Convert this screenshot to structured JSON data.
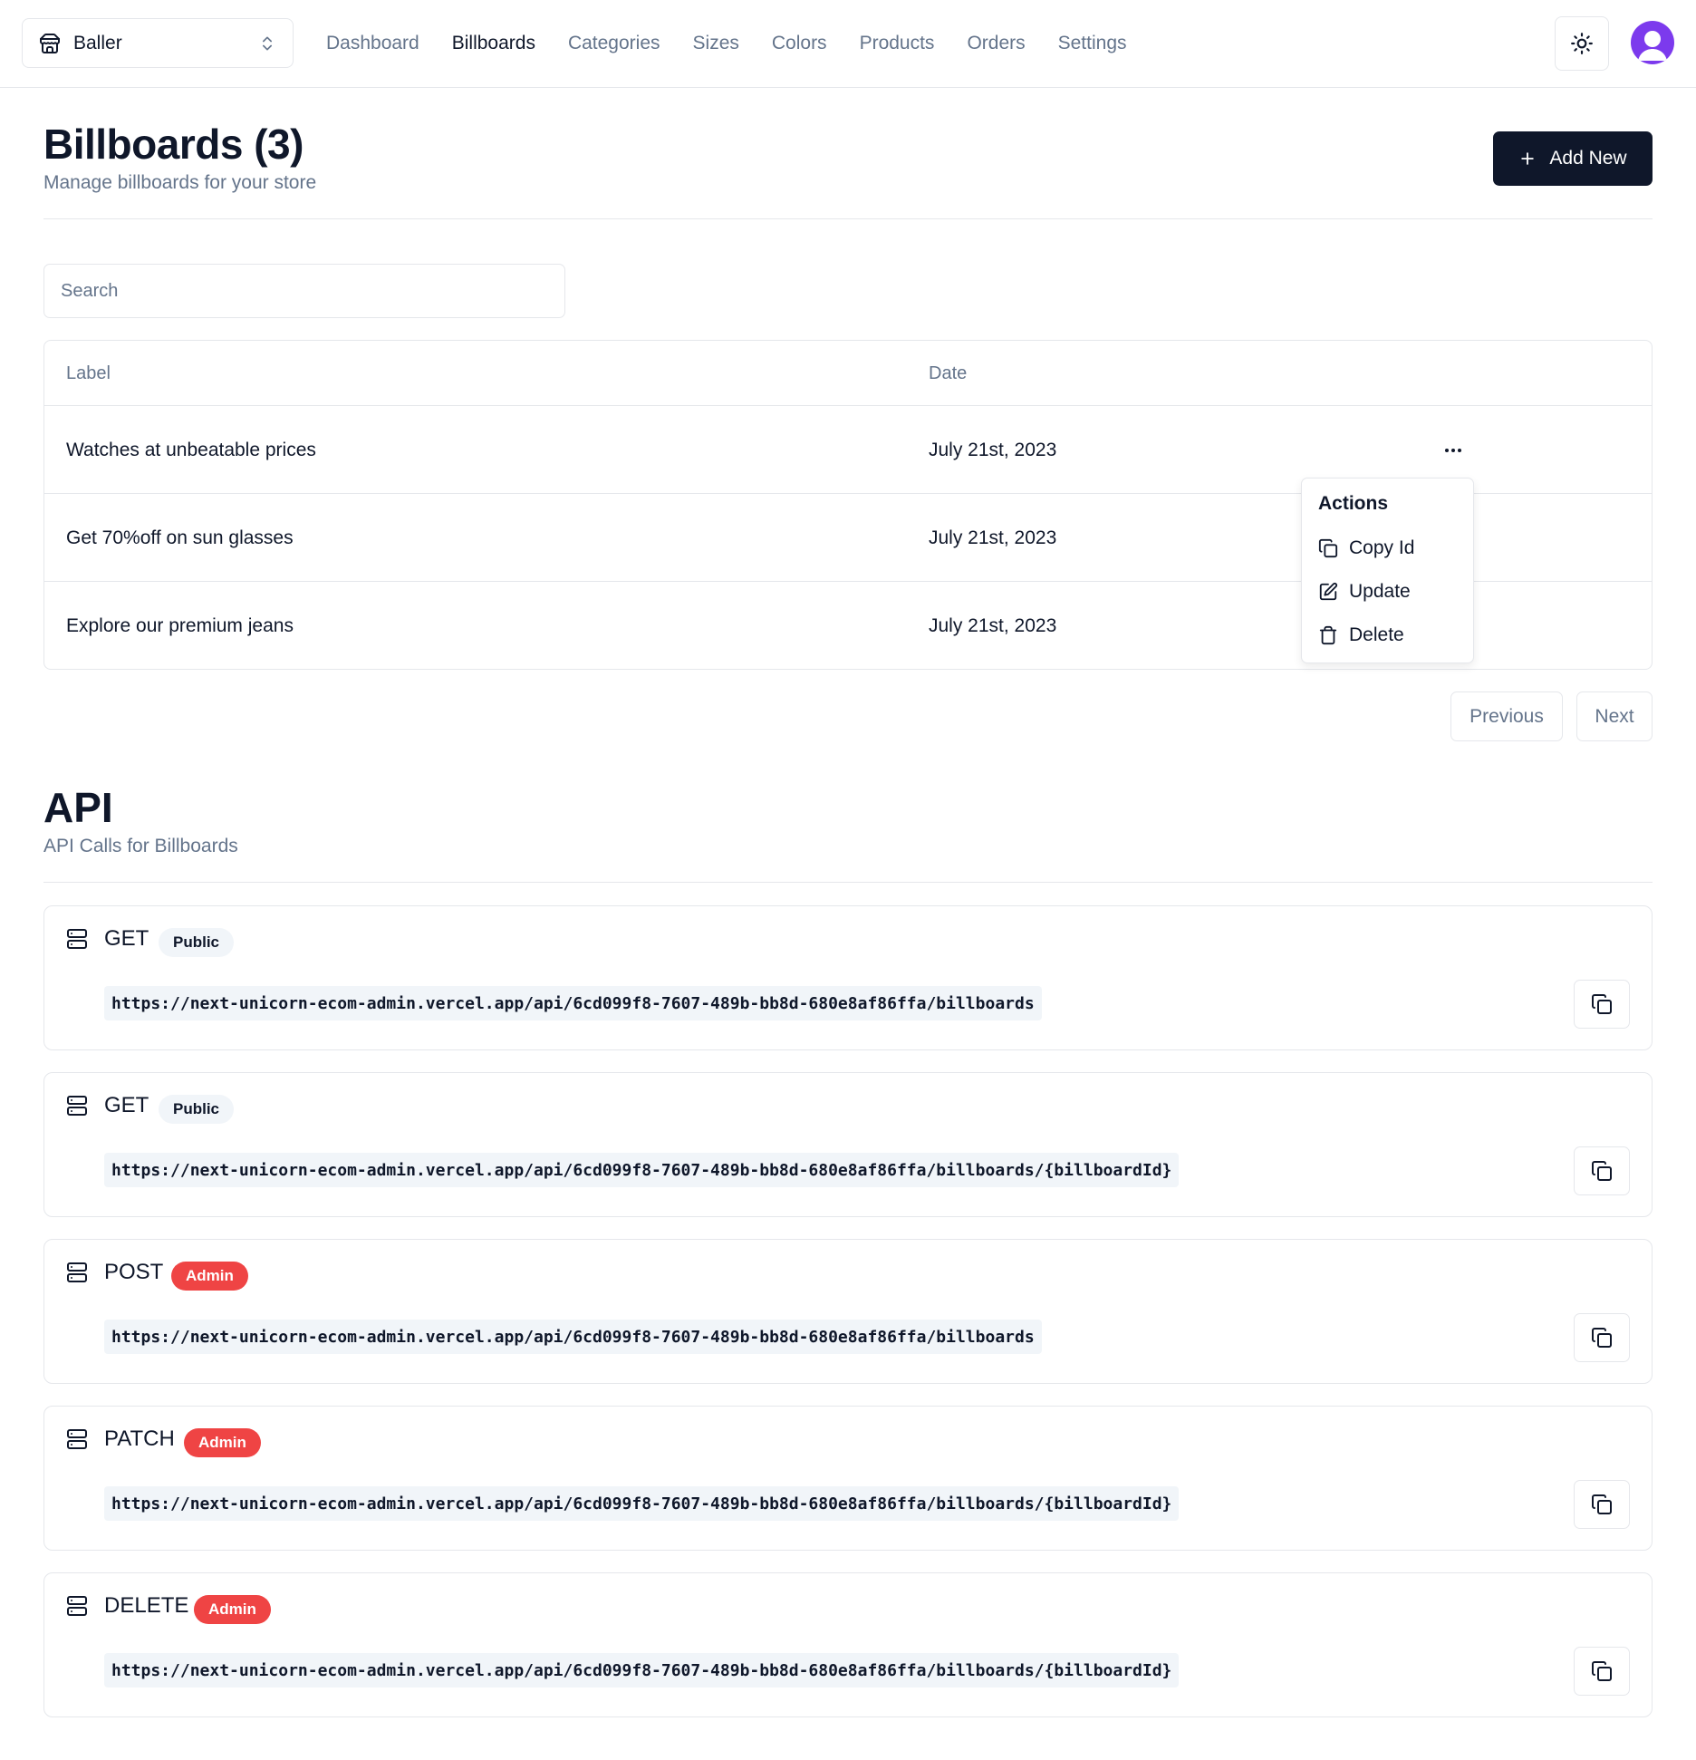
{
  "header": {
    "store_name": "Baller",
    "nav": [
      "Dashboard",
      "Billboards",
      "Categories",
      "Sizes",
      "Colors",
      "Products",
      "Orders",
      "Settings"
    ],
    "active_nav": "Billboards"
  },
  "page": {
    "title": "Billboards (3)",
    "description": "Manage billboards for your store",
    "add_label": "Add New"
  },
  "search": {
    "placeholder": "Search"
  },
  "table": {
    "columns": [
      "Label",
      "Date"
    ],
    "rows": [
      {
        "label": "Watches at unbeatable prices",
        "date": "July 21st, 2023"
      },
      {
        "label": "Get 70%off on sun glasses",
        "date": "July 21st, 2023"
      },
      {
        "label": "Explore our premium jeans",
        "date": "July 21st, 2023"
      }
    ]
  },
  "actions_menu": {
    "label": "Actions",
    "items": [
      "Copy Id",
      "Update",
      "Delete"
    ]
  },
  "pagination": {
    "previous": "Previous",
    "next": "Next"
  },
  "api": {
    "title": "API",
    "description": "API Calls for Billboards",
    "calls": [
      {
        "method": "GET",
        "badge": "Public",
        "url": "https://next-unicorn-ecom-admin.vercel.app/api/6cd099f8-7607-489b-bb8d-680e8af86ffa/billboards"
      },
      {
        "method": "GET",
        "badge": "Public",
        "url": "https://next-unicorn-ecom-admin.vercel.app/api/6cd099f8-7607-489b-bb8d-680e8af86ffa/billboards/{billboardId}"
      },
      {
        "method": "POST",
        "badge": "Admin",
        "url": "https://next-unicorn-ecom-admin.vercel.app/api/6cd099f8-7607-489b-bb8d-680e8af86ffa/billboards"
      },
      {
        "method": "PATCH",
        "badge": "Admin",
        "url": "https://next-unicorn-ecom-admin.vercel.app/api/6cd099f8-7607-489b-bb8d-680e8af86ffa/billboards/{billboardId}"
      },
      {
        "method": "DELETE",
        "badge": "Admin",
        "url": "https://next-unicorn-ecom-admin.vercel.app/api/6cd099f8-7607-489b-bb8d-680e8af86ffa/billboards/{billboardId}"
      }
    ]
  },
  "colors": {
    "primary": "#0f172a",
    "muted": "#64748b",
    "border": "#e5e7eb",
    "admin_badge": "#ef4444",
    "avatar": "#7c3aed"
  },
  "icons": {
    "store": "store-icon",
    "chevrons": "chevrons-up-down-icon",
    "theme": "sun-icon",
    "add": "plus-icon",
    "more": "more-horizontal-icon",
    "copy": "copy-icon",
    "update": "edit-icon",
    "delete": "trash-icon",
    "server": "server-icon"
  }
}
